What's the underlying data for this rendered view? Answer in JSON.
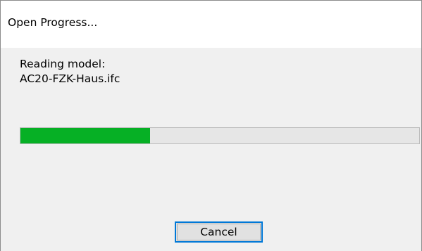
{
  "dialog": {
    "title": "Open Progress...",
    "message_line1": "Reading model:",
    "message_line2": "AC20-FZK-Haus.ifc",
    "progress_fraction": 0.325,
    "cancel_label": "Cancel"
  },
  "colors": {
    "progress_fill": "#06b025",
    "progress_track": "#e6e6e6",
    "button_focus_border": "#0078d7",
    "dialog_body": "#f0f0f0"
  }
}
